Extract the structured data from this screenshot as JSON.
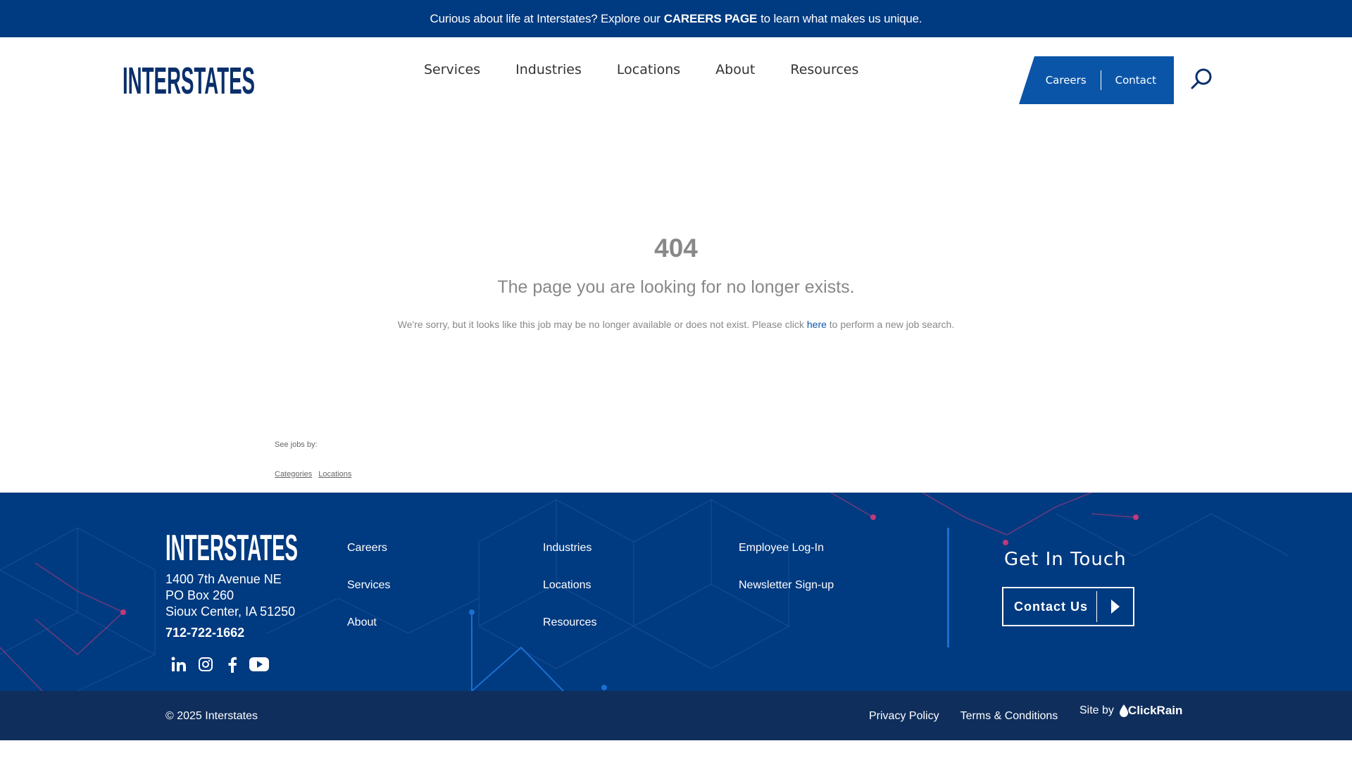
{
  "announcement": {
    "before": "Curious about life at Interstates? Explore our",
    "link": "CAREERS PAGE",
    "after": "to learn what makes us unique."
  },
  "brand": {
    "logo_text": "INTERSTATES",
    "color_primary": "#003a80",
    "color_accent": "#0b55a8",
    "color_bottom": "#0f2e5c"
  },
  "nav": {
    "items": [
      "Services",
      "Industries",
      "Locations",
      "About",
      "Resources"
    ],
    "careers": "Careers",
    "contact": "Contact",
    "search_icon": "search-icon"
  },
  "main": {
    "code": "404",
    "title": "The page you are looking for no longer exists.",
    "msg_before": "We're sorry, but it looks like this job may be no longer available or does not exist. Please click",
    "msg_link": "here",
    "msg_after": "to perform a new job search.",
    "see_jobs": "See jobs by:",
    "links": [
      "Categories",
      "Locations"
    ]
  },
  "footer": {
    "address_line1": "1400 7th Avenue NE",
    "address_line2": "PO Box 260",
    "address_line3": "Sioux Center, IA 51250",
    "phone": "712-722-1662",
    "social": [
      "linkedin-icon",
      "instagram-icon",
      "facebook-icon",
      "youtube-icon"
    ],
    "col1": [
      "Careers",
      "Services",
      "About"
    ],
    "col2": [
      "Industries",
      "Locations",
      "Resources"
    ],
    "col3": [
      "Employee Log-In",
      "Newsletter Sign-up"
    ],
    "get_in_touch": "Get In Touch",
    "contact_us": "Contact Us"
  },
  "bottom": {
    "copyright": "© 2025 Interstates",
    "privacy": "Privacy Policy",
    "terms": "Terms & Conditions",
    "site_by": "Site by",
    "agency": "ClickRain"
  }
}
